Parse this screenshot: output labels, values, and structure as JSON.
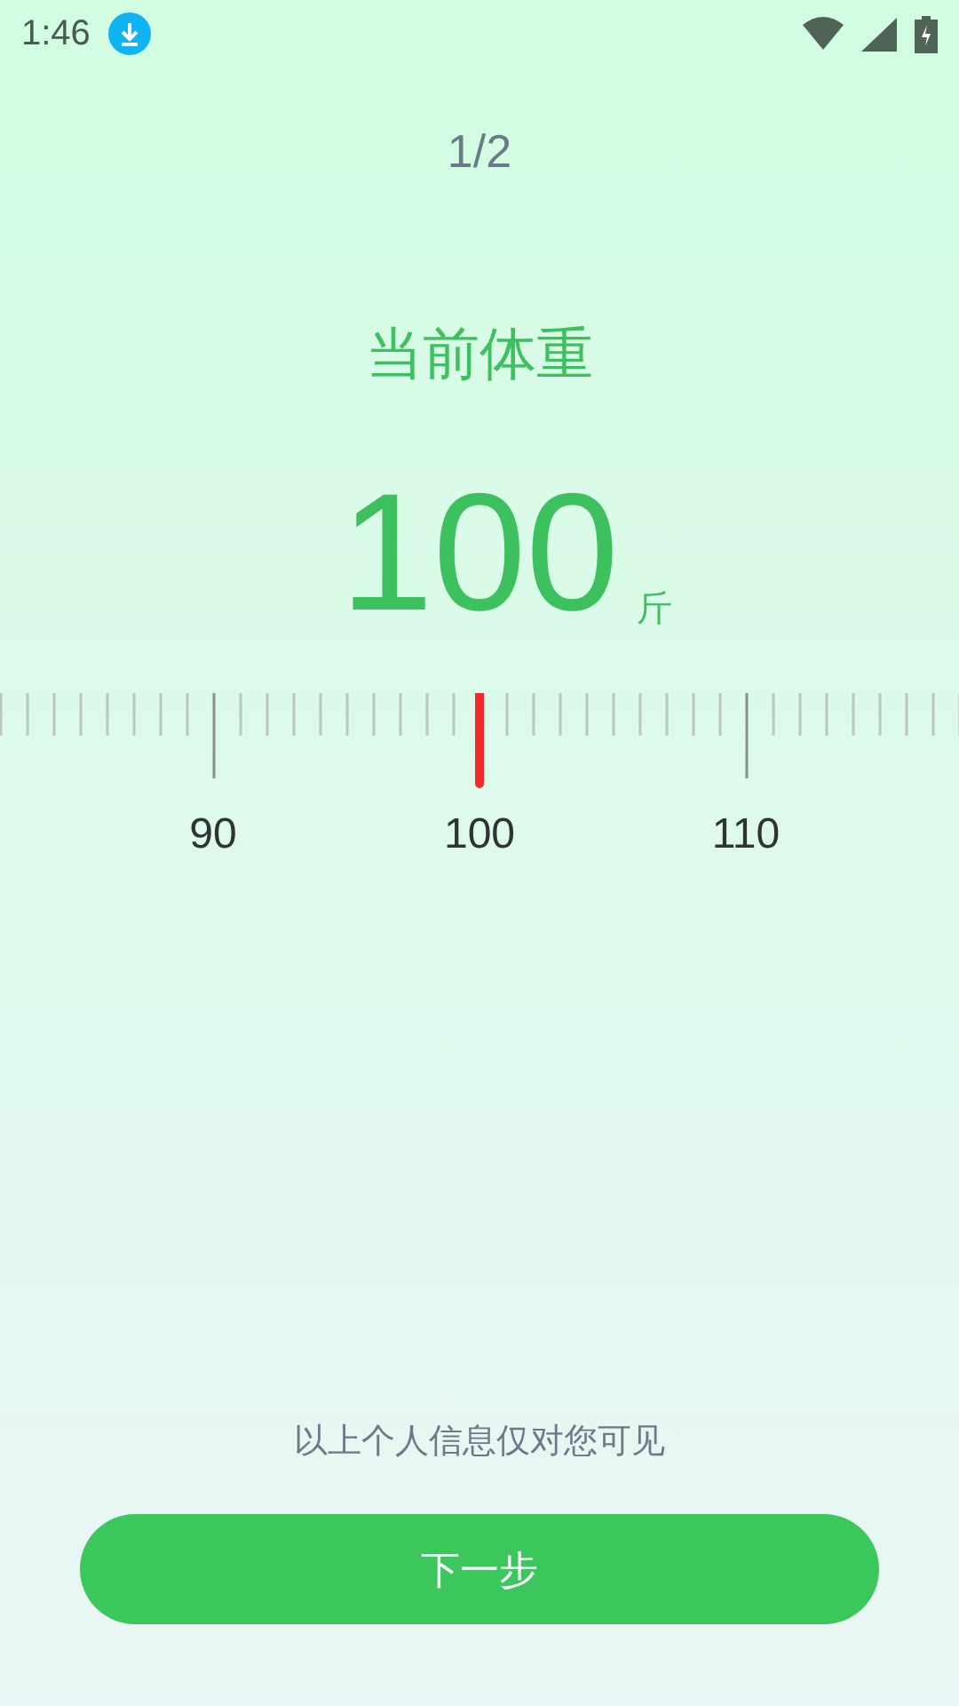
{
  "status_bar": {
    "time": "1:46"
  },
  "step": "1/2",
  "title": "当前体重",
  "weight": {
    "value": "100",
    "unit": "斤"
  },
  "ruler": {
    "labels": [
      "90",
      "100",
      "110"
    ]
  },
  "privacy_note": "以上个人信息仅对您可见",
  "next_button": "下一步"
}
